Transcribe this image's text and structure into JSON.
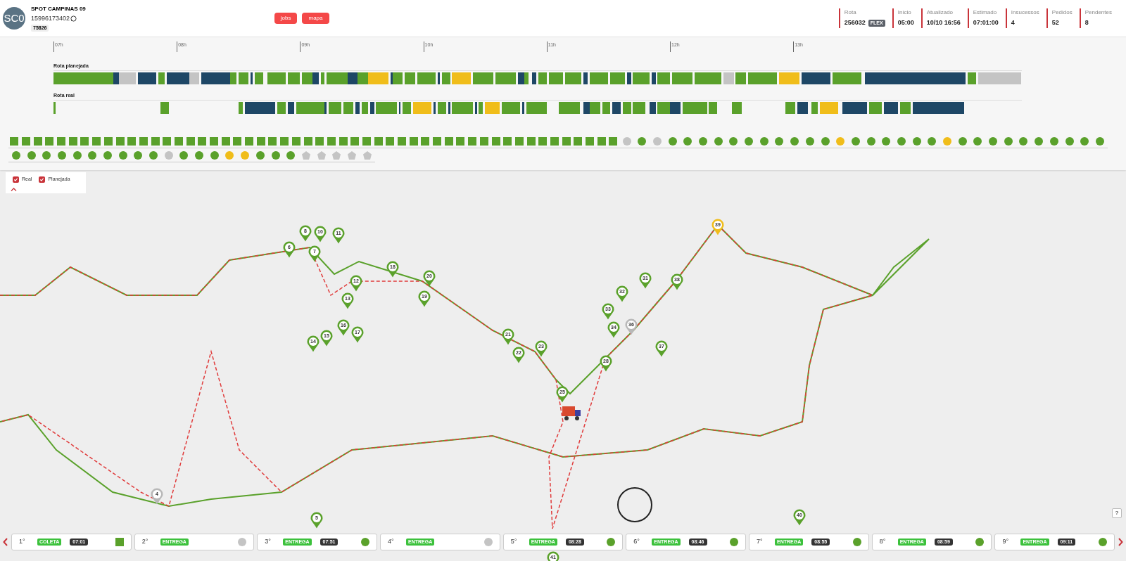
{
  "driver": {
    "avatar": "SC0",
    "name": "SPOT CAMPINAS 09",
    "phone": "15996173402",
    "code": "75826"
  },
  "nav_buttons": [
    "jobs",
    "mapa"
  ],
  "stats": [
    {
      "label": "Rota",
      "value": "256032",
      "badge": "FLEX"
    },
    {
      "label": "Início",
      "value": "05:00"
    },
    {
      "label": "Atualizado",
      "value": "10/10 16:56"
    },
    {
      "label": "Estimado",
      "value": "07:01:00"
    },
    {
      "label": "Insucessos",
      "value": "4"
    },
    {
      "label": "Pedidos",
      "value": "52"
    },
    {
      "label": "Pendentes",
      "value": "8"
    }
  ],
  "timeline": {
    "ticks": [
      "07h",
      "08h",
      "09h",
      "10h",
      "11h",
      "12h",
      "13h"
    ],
    "rows": [
      {
        "title": "Rota planejada",
        "segments": [
          {
            "color": "#5aa12b"
          },
          {
            "color": "#1e4766"
          },
          {
            "color": "#c4c4c4"
          },
          {
            "color": "#1e4766"
          },
          {
            "color": "#5aa12b"
          },
          {
            "color": "#1e4766"
          },
          {
            "color": "#c4c4c4"
          },
          {
            "color": "#1e4766"
          },
          {
            "color": "#5aa12b"
          },
          {
            "color": "#5aa12b"
          },
          {
            "color": "#1e4766"
          },
          {
            "color": "#5aa12b"
          },
          {
            "color": "#5aa12b"
          },
          {
            "color": "#5aa12b"
          },
          {
            "color": "#5aa12b"
          },
          {
            "color": "#1e4766"
          },
          {
            "color": "#5aa12b"
          },
          {
            "color": "#5aa12b"
          },
          {
            "color": "#1e4766"
          },
          {
            "color": "#5aa12b"
          },
          {
            "color": "#f0bd1a"
          },
          {
            "color": "#1e4766"
          },
          {
            "color": "#5aa12b"
          },
          {
            "color": "#5aa12b"
          },
          {
            "color": "#5aa12b"
          },
          {
            "color": "#1e4766"
          },
          {
            "color": "#5aa12b"
          },
          {
            "color": "#f0bd1a"
          },
          {
            "color": "#5aa12b"
          },
          {
            "color": "#5aa12b"
          },
          {
            "color": "#1e4766"
          },
          {
            "color": "#5aa12b"
          },
          {
            "color": "#1e4766"
          },
          {
            "color": "#5aa12b"
          },
          {
            "color": "#5aa12b"
          },
          {
            "color": "#5aa12b"
          },
          {
            "color": "#1e4766"
          },
          {
            "color": "#5aa12b"
          },
          {
            "color": "#5aa12b"
          },
          {
            "color": "#1e4766"
          },
          {
            "color": "#5aa12b"
          },
          {
            "color": "#1e4766"
          },
          {
            "color": "#5aa12b"
          },
          {
            "color": "#5aa12b"
          },
          {
            "color": "#5aa12b"
          },
          {
            "color": "#c4c4c4"
          },
          {
            "color": "#5aa12b"
          },
          {
            "color": "#5aa12b"
          },
          {
            "color": "#f0bd1a"
          },
          {
            "color": "#1e4766"
          },
          {
            "color": "#5aa12b"
          },
          {
            "color": "#1e4766"
          },
          {
            "color": "#5aa12b"
          },
          {
            "color": "#c4c4c4"
          }
        ]
      },
      {
        "title": "Rota real",
        "segments": [
          {
            "color": "#5aa12b"
          },
          {
            "color": "#5aa12b"
          },
          {
            "color": "#5aa12b"
          },
          {
            "color": "#1e4766"
          },
          {
            "color": "#5aa12b"
          },
          {
            "color": "#1e4766"
          },
          {
            "color": "#5aa12b"
          },
          {
            "color": "#5aa12b"
          },
          {
            "color": "#1e4766"
          },
          {
            "color": "#5aa12b"
          },
          {
            "color": "#5aa12b"
          },
          {
            "color": "#1e4766"
          },
          {
            "color": "#5aa12b"
          },
          {
            "color": "#1e4766"
          },
          {
            "color": "#5aa12b"
          },
          {
            "color": "#1e4766"
          },
          {
            "color": "#5aa12b"
          },
          {
            "color": "#f0bd1a"
          },
          {
            "color": "#1e4766"
          },
          {
            "color": "#5aa12b"
          },
          {
            "color": "#1e4766"
          },
          {
            "color": "#5aa12b"
          },
          {
            "color": "#1e4766"
          },
          {
            "color": "#5aa12b"
          },
          {
            "color": "#f0bd1a"
          },
          {
            "color": "#5aa12b"
          },
          {
            "color": "#1e4766"
          },
          {
            "color": "#5aa12b"
          },
          {
            "color": "#5aa12b"
          },
          {
            "color": "#1e4766"
          },
          {
            "color": "#5aa12b"
          },
          {
            "color": "#5aa12b"
          },
          {
            "color": "#1e4766"
          },
          {
            "color": "#5aa12b"
          },
          {
            "color": "#5aa12b"
          },
          {
            "color": "#1e4766"
          },
          {
            "color": "#5aa12b"
          },
          {
            "color": "#1e4766"
          },
          {
            "color": "#5aa12b"
          },
          {
            "color": "#5aa12b"
          },
          {
            "color": "#5aa12b"
          },
          {
            "color": "#5aa12b"
          },
          {
            "color": "#1e4766"
          },
          {
            "color": "#5aa12b"
          },
          {
            "color": "#f0bd1a"
          },
          {
            "color": "#1e4766"
          },
          {
            "color": "#5aa12b"
          },
          {
            "color": "#1e4766"
          },
          {
            "color": "#5aa12b"
          },
          {
            "color": "#1e4766"
          }
        ]
      }
    ]
  },
  "stop_rows": [
    [
      {
        "kind": "square",
        "color": "#5aa12b"
      },
      {
        "kind": "square",
        "color": "#5aa12b"
      },
      {
        "kind": "square",
        "color": "#5aa12b"
      },
      {
        "kind": "square",
        "color": "#5aa12b"
      },
      {
        "kind": "square",
        "color": "#5aa12b"
      },
      {
        "kind": "square",
        "color": "#5aa12b"
      },
      {
        "kind": "square",
        "color": "#5aa12b"
      },
      {
        "kind": "square",
        "color": "#5aa12b"
      },
      {
        "kind": "square",
        "color": "#5aa12b"
      },
      {
        "kind": "square",
        "color": "#5aa12b"
      },
      {
        "kind": "square",
        "color": "#5aa12b"
      },
      {
        "kind": "square",
        "color": "#5aa12b"
      },
      {
        "kind": "square",
        "color": "#5aa12b"
      },
      {
        "kind": "square",
        "color": "#5aa12b"
      },
      {
        "kind": "square",
        "color": "#5aa12b"
      },
      {
        "kind": "square",
        "color": "#5aa12b"
      },
      {
        "kind": "square",
        "color": "#5aa12b"
      },
      {
        "kind": "square",
        "color": "#5aa12b"
      },
      {
        "kind": "square",
        "color": "#5aa12b"
      },
      {
        "kind": "square",
        "color": "#5aa12b"
      },
      {
        "kind": "square",
        "color": "#5aa12b"
      },
      {
        "kind": "square",
        "color": "#5aa12b"
      },
      {
        "kind": "square",
        "color": "#5aa12b"
      },
      {
        "kind": "square",
        "color": "#5aa12b"
      },
      {
        "kind": "square",
        "color": "#5aa12b"
      },
      {
        "kind": "square",
        "color": "#5aa12b"
      },
      {
        "kind": "square",
        "color": "#5aa12b"
      },
      {
        "kind": "square",
        "color": "#5aa12b"
      },
      {
        "kind": "square",
        "color": "#5aa12b"
      },
      {
        "kind": "square",
        "color": "#5aa12b"
      },
      {
        "kind": "square",
        "color": "#5aa12b"
      },
      {
        "kind": "square",
        "color": "#5aa12b"
      },
      {
        "kind": "square",
        "color": "#5aa12b"
      },
      {
        "kind": "square",
        "color": "#5aa12b"
      },
      {
        "kind": "square",
        "color": "#5aa12b"
      },
      {
        "kind": "square",
        "color": "#5aa12b"
      },
      {
        "kind": "square",
        "color": "#5aa12b"
      },
      {
        "kind": "square",
        "color": "#5aa12b"
      },
      {
        "kind": "square",
        "color": "#5aa12b"
      },
      {
        "kind": "square",
        "color": "#5aa12b"
      },
      {
        "kind": "square",
        "color": "#5aa12b"
      },
      {
        "kind": "square",
        "color": "#5aa12b"
      },
      {
        "kind": "square",
        "color": "#5aa12b"
      },
      {
        "kind": "square",
        "color": "#5aa12b"
      },
      {
        "kind": "square",
        "color": "#5aa12b"
      },
      {
        "kind": "square",
        "color": "#5aa12b"
      },
      {
        "kind": "square",
        "color": "#5aa12b"
      },
      {
        "kind": "square",
        "color": "#5aa12b"
      },
      {
        "kind": "square",
        "color": "#5aa12b"
      },
      {
        "kind": "square",
        "color": "#5aa12b"
      },
      {
        "kind": "square",
        "color": "#5aa12b"
      },
      {
        "kind": "square",
        "color": "#5aa12b"
      },
      {
        "kind": "circle",
        "color": "#c4c4c4"
      },
      {
        "kind": "circle",
        "color": "#5aa12b"
      },
      {
        "kind": "circle",
        "color": "#c4c4c4"
      },
      {
        "kind": "circle",
        "color": "#5aa12b"
      },
      {
        "kind": "circle",
        "color": "#5aa12b"
      },
      {
        "kind": "circle",
        "color": "#5aa12b"
      },
      {
        "kind": "circle",
        "color": "#5aa12b"
      },
      {
        "kind": "circle",
        "color": "#5aa12b"
      },
      {
        "kind": "circle",
        "color": "#5aa12b"
      },
      {
        "kind": "circle",
        "color": "#5aa12b"
      },
      {
        "kind": "circle",
        "color": "#5aa12b"
      },
      {
        "kind": "circle",
        "color": "#5aa12b"
      },
      {
        "kind": "circle",
        "color": "#5aa12b"
      },
      {
        "kind": "circle",
        "color": "#5aa12b"
      },
      {
        "kind": "circle",
        "color": "#f0bd1a"
      },
      {
        "kind": "circle",
        "color": "#5aa12b"
      },
      {
        "kind": "circle",
        "color": "#5aa12b"
      },
      {
        "kind": "circle",
        "color": "#5aa12b"
      },
      {
        "kind": "circle",
        "color": "#5aa12b"
      },
      {
        "kind": "circle",
        "color": "#5aa12b"
      },
      {
        "kind": "circle",
        "color": "#5aa12b"
      },
      {
        "kind": "circle",
        "color": "#f0bd1a"
      },
      {
        "kind": "circle",
        "color": "#5aa12b"
      },
      {
        "kind": "circle",
        "color": "#5aa12b"
      },
      {
        "kind": "circle",
        "color": "#5aa12b"
      },
      {
        "kind": "circle",
        "color": "#5aa12b"
      },
      {
        "kind": "circle",
        "color": "#5aa12b"
      },
      {
        "kind": "circle",
        "color": "#5aa12b"
      },
      {
        "kind": "circle",
        "color": "#5aa12b"
      },
      {
        "kind": "circle",
        "color": "#5aa12b"
      },
      {
        "kind": "circle",
        "color": "#5aa12b"
      },
      {
        "kind": "circle",
        "color": "#5aa12b"
      }
    ],
    [
      {
        "kind": "circle",
        "color": "#5aa12b"
      },
      {
        "kind": "circle",
        "color": "#5aa12b"
      },
      {
        "kind": "circle",
        "color": "#5aa12b"
      },
      {
        "kind": "circle",
        "color": "#5aa12b"
      },
      {
        "kind": "circle",
        "color": "#5aa12b"
      },
      {
        "kind": "circle",
        "color": "#5aa12b"
      },
      {
        "kind": "circle",
        "color": "#5aa12b"
      },
      {
        "kind": "circle",
        "color": "#5aa12b"
      },
      {
        "kind": "circle",
        "color": "#5aa12b"
      },
      {
        "kind": "circle",
        "color": "#5aa12b"
      },
      {
        "kind": "circle",
        "color": "#c4c4c4"
      },
      {
        "kind": "circle",
        "color": "#5aa12b"
      },
      {
        "kind": "circle",
        "color": "#5aa12b"
      },
      {
        "kind": "circle",
        "color": "#5aa12b"
      },
      {
        "kind": "circle",
        "color": "#f0bd1a"
      },
      {
        "kind": "circle",
        "color": "#f0bd1a"
      },
      {
        "kind": "circle",
        "color": "#5aa12b"
      },
      {
        "kind": "circle",
        "color": "#5aa12b"
      },
      {
        "kind": "circle",
        "color": "#5aa12b"
      },
      {
        "kind": "pentagon",
        "color": "#c4c4c4"
      },
      {
        "kind": "pentagon",
        "color": "#c4c4c4"
      },
      {
        "kind": "pentagon",
        "color": "#c4c4c4"
      },
      {
        "kind": "pentagon",
        "color": "#c4c4c4"
      },
      {
        "kind": "pentagon",
        "color": "#c4c4c4"
      }
    ]
  ],
  "legend": [
    {
      "label": "Real",
      "checked": true
    },
    {
      "label": "Planejada",
      "checked": true
    }
  ],
  "pins": [
    {
      "label": "4",
      "color": "#b8b8b8"
    },
    {
      "label": "5",
      "color": "#5aa12b"
    },
    {
      "label": "6",
      "color": "#5aa12b"
    },
    {
      "label": "7",
      "color": "#5aa12b"
    },
    {
      "label": "8",
      "color": "#5aa12b"
    },
    {
      "label": "10",
      "color": "#5aa12b"
    },
    {
      "label": "11",
      "color": "#5aa12b"
    },
    {
      "label": "12",
      "color": "#5aa12b"
    },
    {
      "label": "13",
      "color": "#5aa12b"
    },
    {
      "label": "14",
      "color": "#5aa12b"
    },
    {
      "label": "15",
      "color": "#5aa12b"
    },
    {
      "label": "16",
      "color": "#5aa12b"
    },
    {
      "label": "17",
      "color": "#5aa12b"
    },
    {
      "label": "18",
      "color": "#5aa12b"
    },
    {
      "label": "19",
      "color": "#5aa12b"
    },
    {
      "label": "20",
      "color": "#5aa12b"
    },
    {
      "label": "21",
      "color": "#5aa12b"
    },
    {
      "label": "22",
      "color": "#5aa12b"
    },
    {
      "label": "23",
      "color": "#5aa12b"
    },
    {
      "label": "25",
      "color": "#5aa12b"
    },
    {
      "label": "28",
      "color": "#5aa12b"
    },
    {
      "label": "31",
      "color": "#5aa12b"
    },
    {
      "label": "32",
      "color": "#5aa12b"
    },
    {
      "label": "33",
      "color": "#5aa12b"
    },
    {
      "label": "34",
      "color": "#5aa12b"
    },
    {
      "label": "36",
      "color": "#b8b8b8"
    },
    {
      "label": "37",
      "color": "#5aa12b"
    },
    {
      "label": "38",
      "color": "#5aa12b"
    },
    {
      "label": "39",
      "color": "#f0bd1a"
    },
    {
      "label": "40",
      "color": "#5aa12b"
    },
    {
      "label": "41",
      "color": "#5aa12b"
    }
  ],
  "cards": [
    {
      "position": "1°",
      "type": "COLETA",
      "time": "07:01",
      "kind": "square",
      "color": "#5aa12b"
    },
    {
      "position": "2°",
      "type": "ENTREGA",
      "kind": "circle",
      "color": "#c4c4c4"
    },
    {
      "position": "3°",
      "type": "ENTREGA",
      "time": "07:51",
      "kind": "circle",
      "color": "#5aa12b"
    },
    {
      "position": "4°",
      "type": "ENTREGA",
      "kind": "circle",
      "color": "#c4c4c4"
    },
    {
      "position": "5°",
      "type": "ENTREGA",
      "time": "08:28",
      "kind": "circle",
      "color": "#5aa12b"
    },
    {
      "position": "6°",
      "type": "ENTREGA",
      "time": "08:46",
      "kind": "circle",
      "color": "#5aa12b"
    },
    {
      "position": "7°",
      "type": "ENTREGA",
      "time": "08:55",
      "kind": "circle",
      "color": "#5aa12b"
    },
    {
      "position": "8°",
      "type": "ENTREGA",
      "time": "08:59",
      "kind": "circle",
      "color": "#5aa12b"
    },
    {
      "position": "9°",
      "type": "ENTREGA",
      "time": "09:11",
      "kind": "circle",
      "color": "#5aa12b"
    }
  ],
  "help": "?"
}
